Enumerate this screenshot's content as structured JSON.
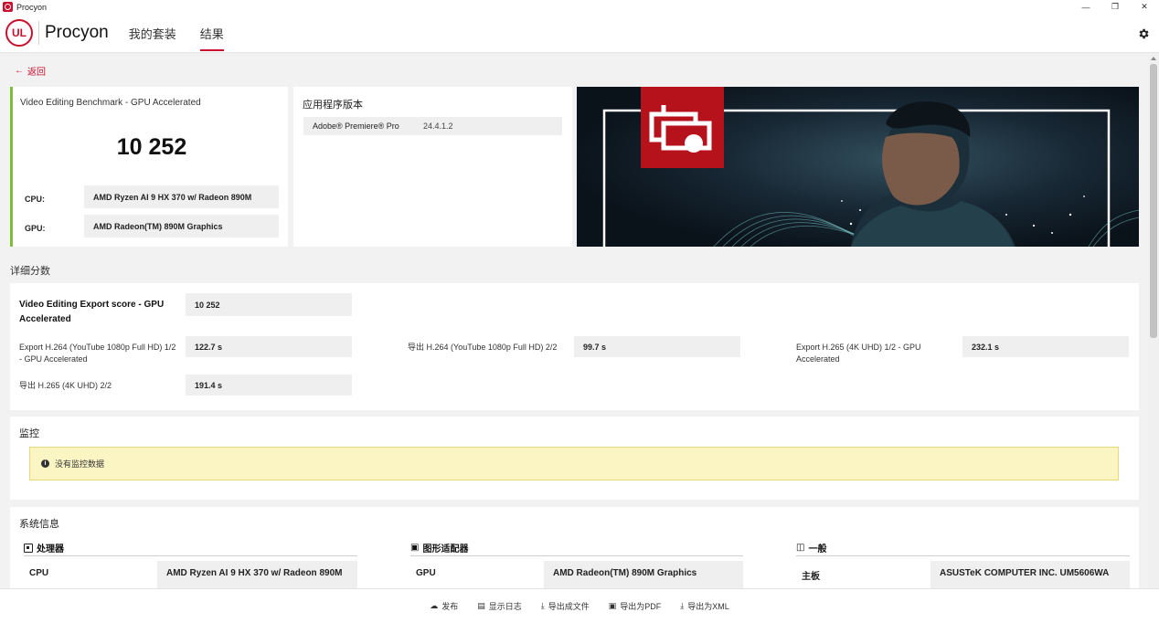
{
  "window": {
    "title": "Procyon",
    "minimize": "—",
    "maximize": "❐",
    "close": "✕"
  },
  "header": {
    "logo": "UL",
    "brand": "Procyon",
    "nav": [
      {
        "label": "我的套装"
      },
      {
        "label": "结果"
      }
    ]
  },
  "back": {
    "label": "返回",
    "icon": "←"
  },
  "score": {
    "title": "Video Editing Benchmark - GPU Accelerated",
    "value": "10 252",
    "cpu_label": "CPU:",
    "cpu_value": "AMD Ryzen AI 9 HX 370 w/ Radeon 890M",
    "gpu_label": "GPU:",
    "gpu_value": "AMD Radeon(TM) 890M Graphics",
    "accent": "#7cbf3a"
  },
  "version": {
    "title": "应用程序版本",
    "app": "Adobe® Premiere® Pro",
    "value": "24.4.1.2"
  },
  "details": {
    "section": "详细分数",
    "main_label": "Video Editing Export score - GPU Accelerated",
    "main_value": "10 252",
    "items": [
      {
        "label": "Export H.264 (YouTube 1080p Full HD) 1/2 - GPU Accelerated",
        "value": "122.7 s"
      },
      {
        "label": "导出 H.264 (YouTube 1080p Full HD) 2/2",
        "value": "99.7 s"
      },
      {
        "label": "Export H.265 (4K UHD) 1/2 - GPU Accelerated",
        "value": "232.1 s"
      },
      {
        "label": "导出 H.265 (4K UHD) 2/2",
        "value": "191.4 s"
      }
    ]
  },
  "monitor": {
    "title": "监控",
    "notice": "没有监控数据",
    "notice_icon": "i"
  },
  "system": {
    "title": "系统信息",
    "columns": [
      {
        "heading": "处理器",
        "key": "CPU",
        "value": "AMD Ryzen AI 9 HX 370 w/ Radeon 890M"
      },
      {
        "heading": "图形适配器",
        "key": "GPU",
        "value": "AMD Radeon(TM) 890M Graphics"
      },
      {
        "heading": "一般",
        "key": "主板",
        "value": "ASUSTeK COMPUTER INC. UM5606WA"
      }
    ]
  },
  "footer": {
    "buttons": [
      {
        "label": "发布",
        "icon": "☁"
      },
      {
        "label": "显示日志",
        "icon": "▤"
      },
      {
        "label": "导出成文件",
        "icon": "⤓"
      },
      {
        "label": "导出为PDF",
        "icon": "▣"
      },
      {
        "label": "导出为XML",
        "icon": "⤓"
      }
    ]
  },
  "colors": {
    "brand_red": "#c8102e",
    "notice_bg": "#fbf5c4"
  }
}
